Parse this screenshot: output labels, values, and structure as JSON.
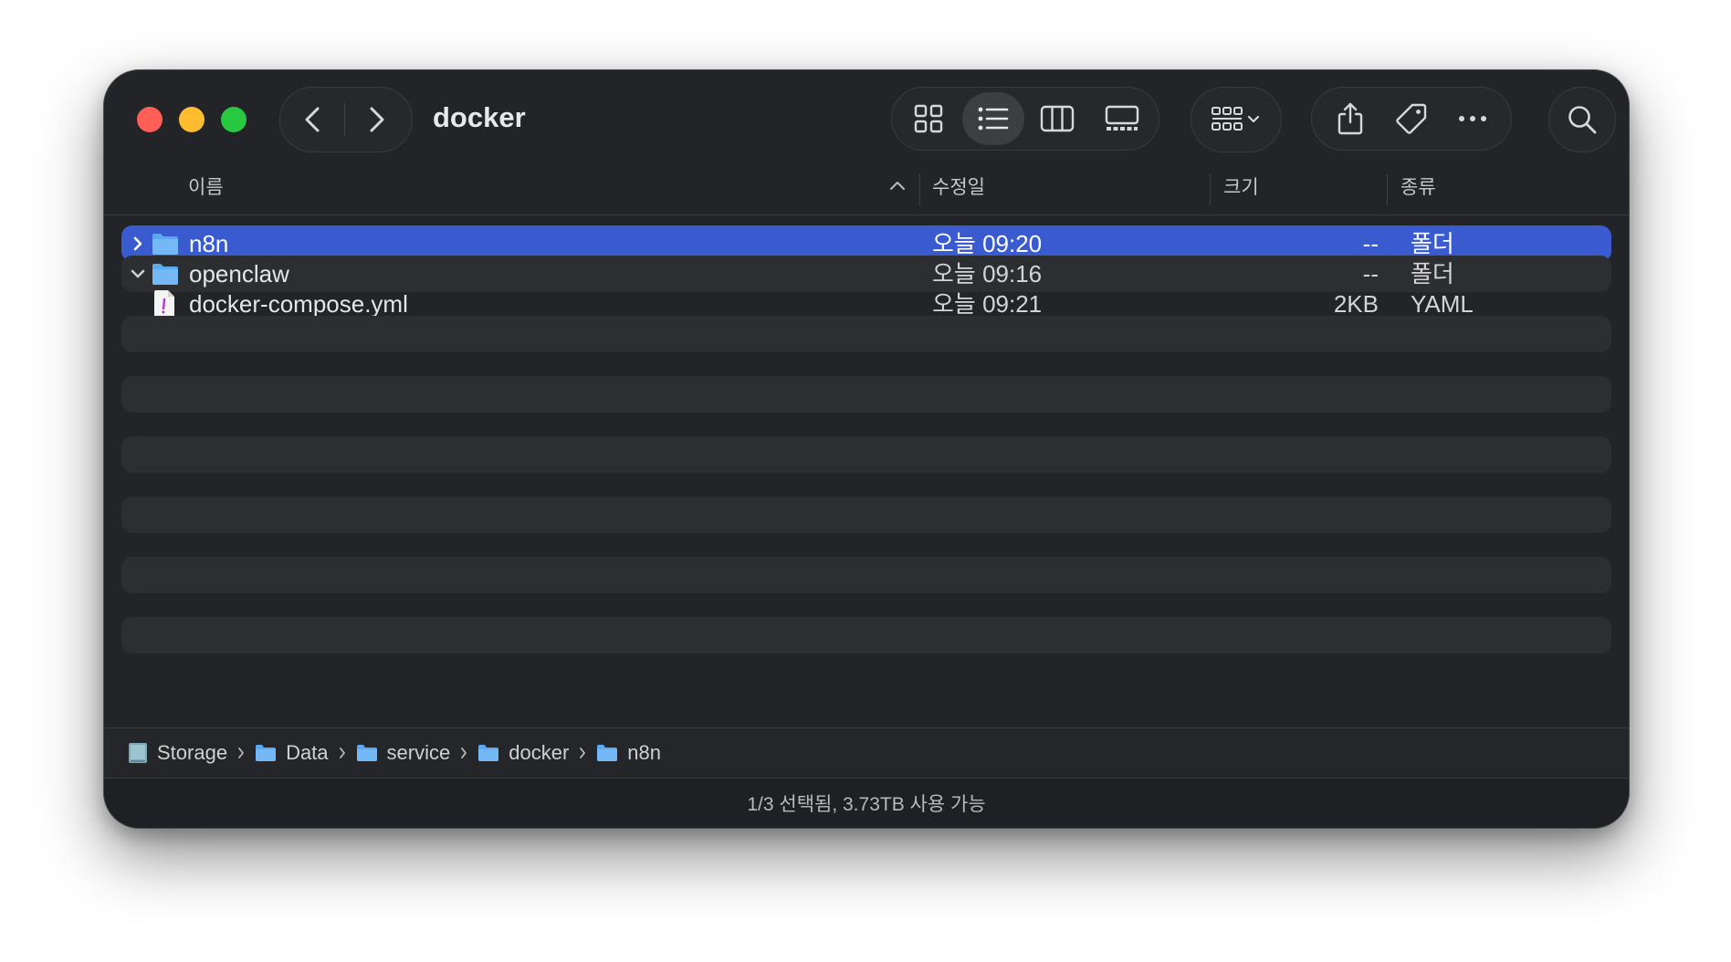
{
  "window": {
    "title": "docker"
  },
  "toolbar": {
    "back_icon": "chevron-left-icon",
    "forward_icon": "chevron-right-icon",
    "views": [
      {
        "name": "icon-view",
        "icon": "grid-icon",
        "active": false
      },
      {
        "name": "list-view",
        "icon": "list-icon",
        "active": true
      },
      {
        "name": "column-view",
        "icon": "columns-icon",
        "active": false
      },
      {
        "name": "gallery-view",
        "icon": "gallery-icon",
        "active": false
      }
    ],
    "group_icon": "group-icon",
    "share_icon": "share-icon",
    "tag_icon": "tag-icon",
    "more_icon": "ellipsis-icon",
    "search_icon": "search-icon"
  },
  "columns": {
    "name": "이름",
    "date": "수정일",
    "size": "크기",
    "kind": "종류"
  },
  "files": [
    {
      "name": "n8n",
      "date": "오늘 09:20",
      "size": "--",
      "kind": "폴더",
      "type": "folder",
      "disclosure": "collapsed",
      "selected": true
    },
    {
      "name": "openclaw",
      "date": "오늘 09:16",
      "size": "--",
      "kind": "폴더",
      "type": "folder",
      "disclosure": "expanded",
      "selected": false
    },
    {
      "name": "docker-compose.yml",
      "date": "오늘 09:21",
      "size": "2KB",
      "kind": "YAML",
      "type": "yaml",
      "disclosure": "none",
      "selected": false
    }
  ],
  "pathbar": [
    {
      "label": "Storage",
      "icon": "drive-icon"
    },
    {
      "label": "Data",
      "icon": "folder-icon"
    },
    {
      "label": "service",
      "icon": "folder-icon"
    },
    {
      "label": "docker",
      "icon": "folder-icon"
    },
    {
      "label": "n8n",
      "icon": "folder-icon"
    }
  ],
  "status": {
    "text": "1/3 선택됨, 3.73TB 사용 가능"
  },
  "colors": {
    "selection": "#3a5bd0",
    "folder": "#5aa8ef",
    "close": "#ff5f57",
    "minimize": "#febc2e",
    "maximize": "#28c840"
  }
}
